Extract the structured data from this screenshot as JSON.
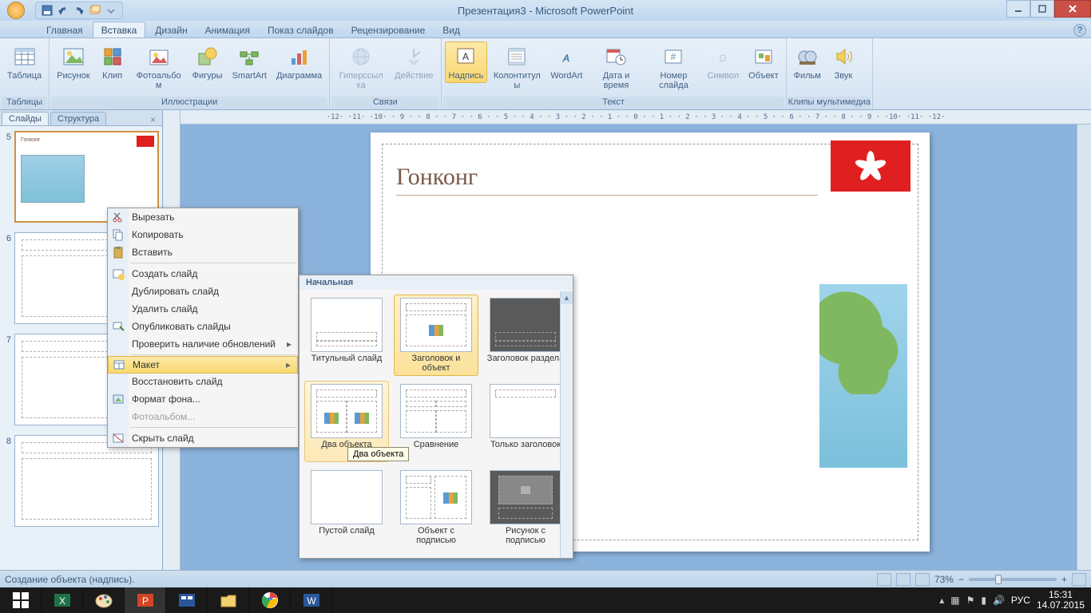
{
  "titlebar": {
    "title": "Презентация3 - Microsoft PowerPoint"
  },
  "tabs": [
    "Главная",
    "Вставка",
    "Дизайн",
    "Анимация",
    "Показ слайдов",
    "Рецензирование",
    "Вид"
  ],
  "active_tab": 1,
  "ribbon": {
    "g_tables": {
      "label": "Таблицы",
      "table": "Таблица"
    },
    "g_illustrations": {
      "label": "Иллюстрации",
      "picture": "Рисунок",
      "clip": "Клип",
      "album": "Фотоальбом",
      "shapes": "Фигуры",
      "smartart": "SmartArt",
      "chart": "Диаграмма"
    },
    "g_links": {
      "label": "Связи",
      "hyperlink": "Гиперссылка",
      "action": "Действие"
    },
    "g_text": {
      "label": "Текст",
      "textbox": "Надпись",
      "hf": "Колонтитулы",
      "wordart": "WordArt",
      "datetime": "Дата и время",
      "slidenum": "Номер слайда",
      "symbol": "Символ",
      "object": "Объект"
    },
    "g_media": {
      "label": "Клипы мультимедиа",
      "movie": "Фильм",
      "sound": "Звук"
    }
  },
  "slide_panel": {
    "tab_slides": "Слайды",
    "tab_outline": "Структура",
    "nums": [
      "5",
      "6",
      "7",
      "8"
    ],
    "thumb5_title": "Гонконг"
  },
  "canvas": {
    "title": "Гонконг",
    "ruler": "·12· ·11· ·10· · 9 · · 8 · · 7 · · 6 · · 5 · · 4 · · 3 · · 2 · · 1 · · 0 · · 1 · · 2 · · 3 · · 4 · · 5 · · 6 · · 7 · · 8 · · 9 · ·10· ·11· ·12·"
  },
  "context_menu": {
    "cut": "Вырезать",
    "copy": "Копировать",
    "paste": "Вставить",
    "new_slide": "Создать слайд",
    "dup_slide": "Дублировать слайд",
    "del_slide": "Удалить слайд",
    "pub_slides": "Опубликовать слайды",
    "check_upd": "Проверить наличие обновлений",
    "layout": "Макет",
    "reset": "Восстановить слайд",
    "format_bg": "Формат фона...",
    "album": "Фотоальбом...",
    "hide": "Скрыть слайд"
  },
  "layout_flyout": {
    "header": "Начальная",
    "items": [
      "Титульный слайд",
      "Заголовок и объект",
      "Заголовок раздела",
      "Два объекта",
      "Сравнение",
      "Только заголовок",
      "Пустой слайд",
      "Объект с подписью",
      "Рисунок с подписью"
    ]
  },
  "tooltip": "Два объекта",
  "status": {
    "left": "Создание объекта (надпись).",
    "zoom": "73%"
  },
  "tray": {
    "lang": "РУС",
    "time": "15:31",
    "date": "14.07.2015"
  }
}
